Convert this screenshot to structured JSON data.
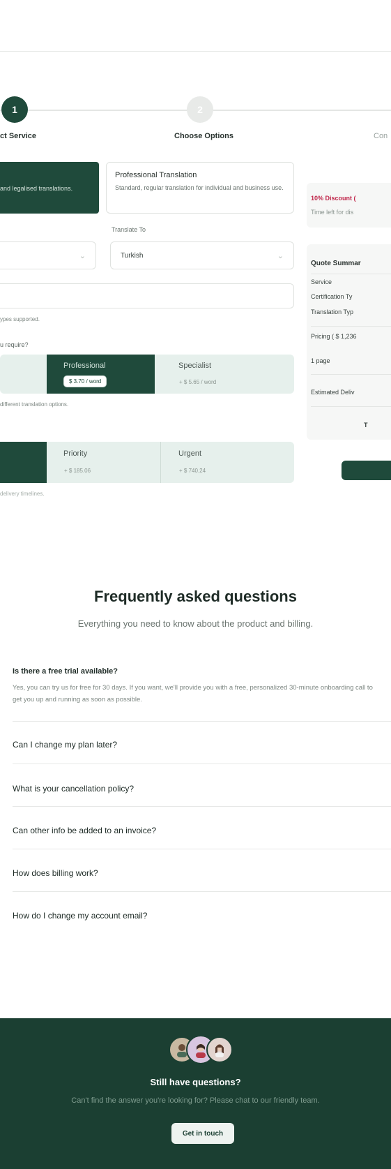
{
  "colors": {
    "brand": "#1f4a3b",
    "brand_dark": "#1b3f32",
    "tier_bg": "#e6f0ec",
    "discount": "#c0264a"
  },
  "stepper": {
    "steps": [
      {
        "number": "1",
        "label": "ct Service",
        "state": "active"
      },
      {
        "number": "2",
        "label": "Choose Options",
        "state": "inactive"
      },
      {
        "number": "",
        "label": "Con",
        "state": "inactive"
      }
    ]
  },
  "service": {
    "certified_desc": "and legalised translations.",
    "professional_title": "Professional Translation",
    "professional_desc": "Standard, regular translation for individual and business use."
  },
  "languages": {
    "to_label": "Translate To",
    "to_value": "Turkish"
  },
  "upload": {
    "hint": "ypes supported."
  },
  "quality": {
    "question": "u require?",
    "tiers": [
      {
        "name": "Professional",
        "price": "$ 3.70 / word",
        "selected": true
      },
      {
        "name": "Specialist",
        "price": "+ $ 5.65 / word",
        "selected": false
      }
    ],
    "hint": "different translation options."
  },
  "delivery": {
    "tiers": [
      {
        "name": "Priority",
        "price": "+ $ 185.06"
      },
      {
        "name": "Urgent",
        "price": "+ $ 740.24"
      }
    ],
    "hint": "delivery timelines."
  },
  "discount": {
    "title": "10% Discount (",
    "subtitle": "Time left for dis"
  },
  "quote": {
    "title": "Quote Summar",
    "rows": [
      "Service",
      "Certification Ty",
      "Translation Typ"
    ],
    "pricing": "Pricing ( $ 1,236",
    "pages": "1 page",
    "estimated": "Estimated Deliv",
    "total": "T"
  },
  "faq": {
    "title": "Frequently asked questions",
    "subtitle": "Everything you need to know about the product and billing.",
    "items": [
      {
        "q": "Is there a free trial available?",
        "a": "Yes, you can try us for free for 30 days. If you want, we'll provide you with a free, personalized 30-minute onboarding call to get you up and running as soon as possible."
      },
      {
        "q": "Can I change my plan later?"
      },
      {
        "q": "What is your cancellation policy?"
      },
      {
        "q": "Can other info be added to an invoice?"
      },
      {
        "q": "How does billing work?"
      },
      {
        "q": "How do I change my account email?"
      }
    ]
  },
  "cta": {
    "title": "Still have questions?",
    "subtitle": "Can't find the answer you're looking for? Please chat to our friendly team.",
    "button": "Get in touch"
  }
}
